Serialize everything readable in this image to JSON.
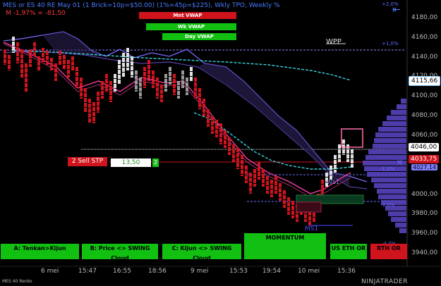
{
  "header": {
    "title": "MES or ES 40 RE May 01  (1 Brick=10p=$50.00) (1%=45p=$225), Wkly TPO, Weekly %",
    "subline": "M -1,97% = -81,50"
  },
  "vwap_buttons": [
    {
      "label": "Mnt VWAP",
      "color": "#d0141e"
    },
    {
      "label": "Wk VWAP",
      "color": "#12c012"
    },
    {
      "label": "Day VWAP",
      "color": "#12c012"
    }
  ],
  "wpp_label": "WPP",
  "y_axis": {
    "ticks": [
      "4180,00",
      "4160,00",
      "4140,00",
      "4120,00",
      "4100,00",
      "4080,00",
      "4060,00",
      "4040,00",
      "4020,00",
      "4000,00",
      "3980,00",
      "3960,00",
      "3940,00"
    ],
    "highlight_prices": [
      {
        "label": "4115,66",
        "color": "#7fc8ff",
        "bg": "#ffffff",
        "text_color": "#000000"
      },
      {
        "label": "4046,00",
        "bg": "#ffffff",
        "text_color": "#000000"
      },
      {
        "label": "4033,75",
        "bg": "#d0141e",
        "text_color": "#ffffff"
      },
      {
        "label": "4027,14",
        "bg": "#8080ff",
        "text_color": "#000000"
      }
    ]
  },
  "pct_labels": [
    "+2,0%",
    "+1,0%",
    "-1,0%",
    "-3,0%",
    "-4,0%"
  ],
  "x_axis": [
    "6 mei",
    "15:47",
    "16:55",
    "18:56",
    "9 mei",
    "15:53",
    "19:54",
    "10 mei",
    "15:36"
  ],
  "stop_box": {
    "label": "2  Sell STP",
    "value": "13,50",
    "count": "2"
  },
  "markers": {
    "ms1": "MS1",
    "ws1": "WS1"
  },
  "bottom_buttons": [
    {
      "label": "A: Tenkan>Kijun",
      "bg": "#12c012"
    },
    {
      "label": "B: Price <> SWING Cloud",
      "bg": "#12c012"
    },
    {
      "label": "C: Kijun <> SWING Cloud",
      "bg": "#12c012"
    },
    {
      "label": "MOMENTUM",
      "bg": "#12c012"
    },
    {
      "label": "US ETH OR",
      "bg": "#12c012"
    },
    {
      "label": "RTH OR",
      "bg": "#d0141e"
    }
  ],
  "footer": {
    "left": "MES 40 Renko",
    "right": "NINJATRADER"
  }
}
